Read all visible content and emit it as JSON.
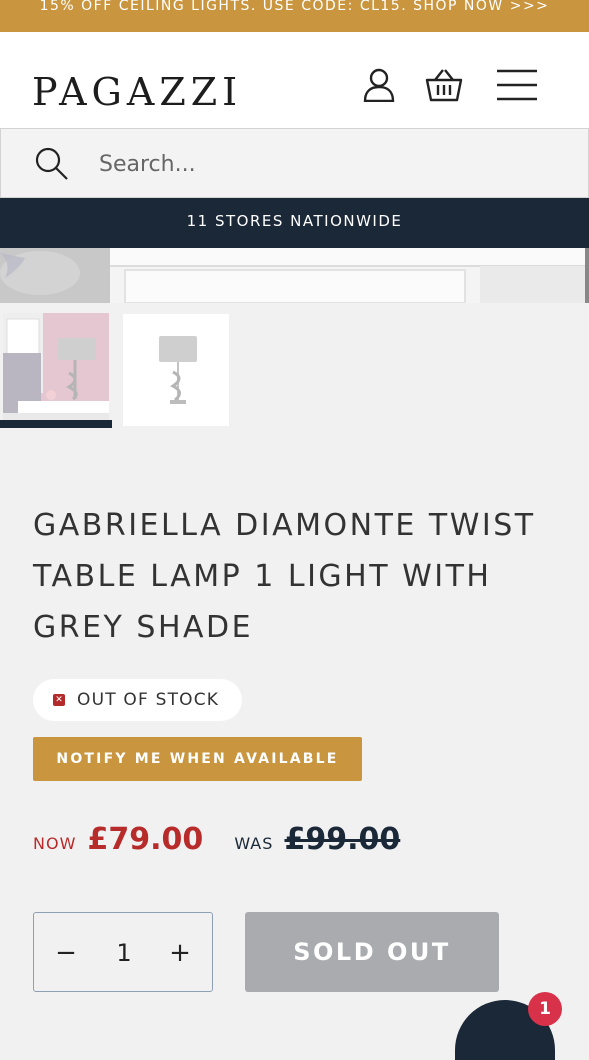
{
  "promo": {
    "text": "15% OFF CEILING LIGHTS. USE CODE: CL15. SHOP NOW >>>"
  },
  "header": {
    "logo": "PAGAZZI",
    "icons": [
      "account-icon",
      "basket-icon",
      "menu-icon"
    ]
  },
  "search": {
    "placeholder": "Search..."
  },
  "stores_bar": {
    "text": "11 STORES NATIONWIDE"
  },
  "product": {
    "title": "GABRIELLA DIAMONTE TWIST TABLE LAMP 1 LIGHT WITH GREY SHADE",
    "stock_status": "OUT OF STOCK",
    "notify_label": "NOTIFY ME WHEN AVAILABLE",
    "price": {
      "now_label": "NOW",
      "now_value": "£79.00",
      "was_label": "WAS",
      "was_value": "£99.00"
    },
    "quantity": "1",
    "sold_out_label": "SOLD OUT"
  },
  "chat": {
    "badge_count": "1"
  },
  "colors": {
    "accent": "#c9953f",
    "navy": "#1b2838",
    "price_red": "#b72b2b",
    "out_of_stock_red": "#b32a2a"
  }
}
